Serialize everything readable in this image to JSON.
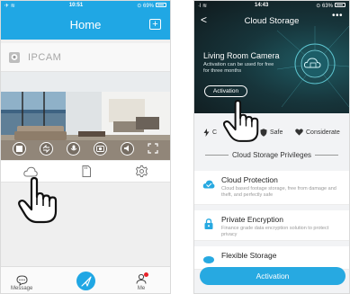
{
  "left": {
    "status": {
      "left": "✈ ≋",
      "time": "10:51",
      "battery": "⊙ 69%"
    },
    "header": {
      "title": "Home",
      "add_symbol": "+"
    },
    "camera": {
      "name": "IPCAM"
    },
    "tabs": {
      "message": "Message",
      "me": "Me"
    }
  },
  "right": {
    "status": {
      "left": "·l ≋",
      "time": "14:43",
      "battery": "⊙ 63%"
    },
    "header": {
      "title": "Cloud Storage",
      "back": "<",
      "more": "•••"
    },
    "hero": {
      "title": "Living Room Camera",
      "desc": "Activation can be used for free for three months",
      "activation": "Activation"
    },
    "features": {
      "a": "C",
      "b": "Safe",
      "c": "Considerate"
    },
    "privileges": "Cloud Storage Privileges",
    "cards": [
      {
        "title": "Cloud Protection",
        "desc": "Cloud based footage storage, free from damage and theft, and perfectly safe"
      },
      {
        "title": "Private Encryption",
        "desc": "Finance grade data encryption solution to protect privacy"
      },
      {
        "title": "Flexible Storage",
        "desc": ""
      }
    ],
    "activation_button": "Activation"
  },
  "colors": {
    "accent": "#20a7e4",
    "notice_red": "#e8232a",
    "hero_dark": "#17353b"
  }
}
